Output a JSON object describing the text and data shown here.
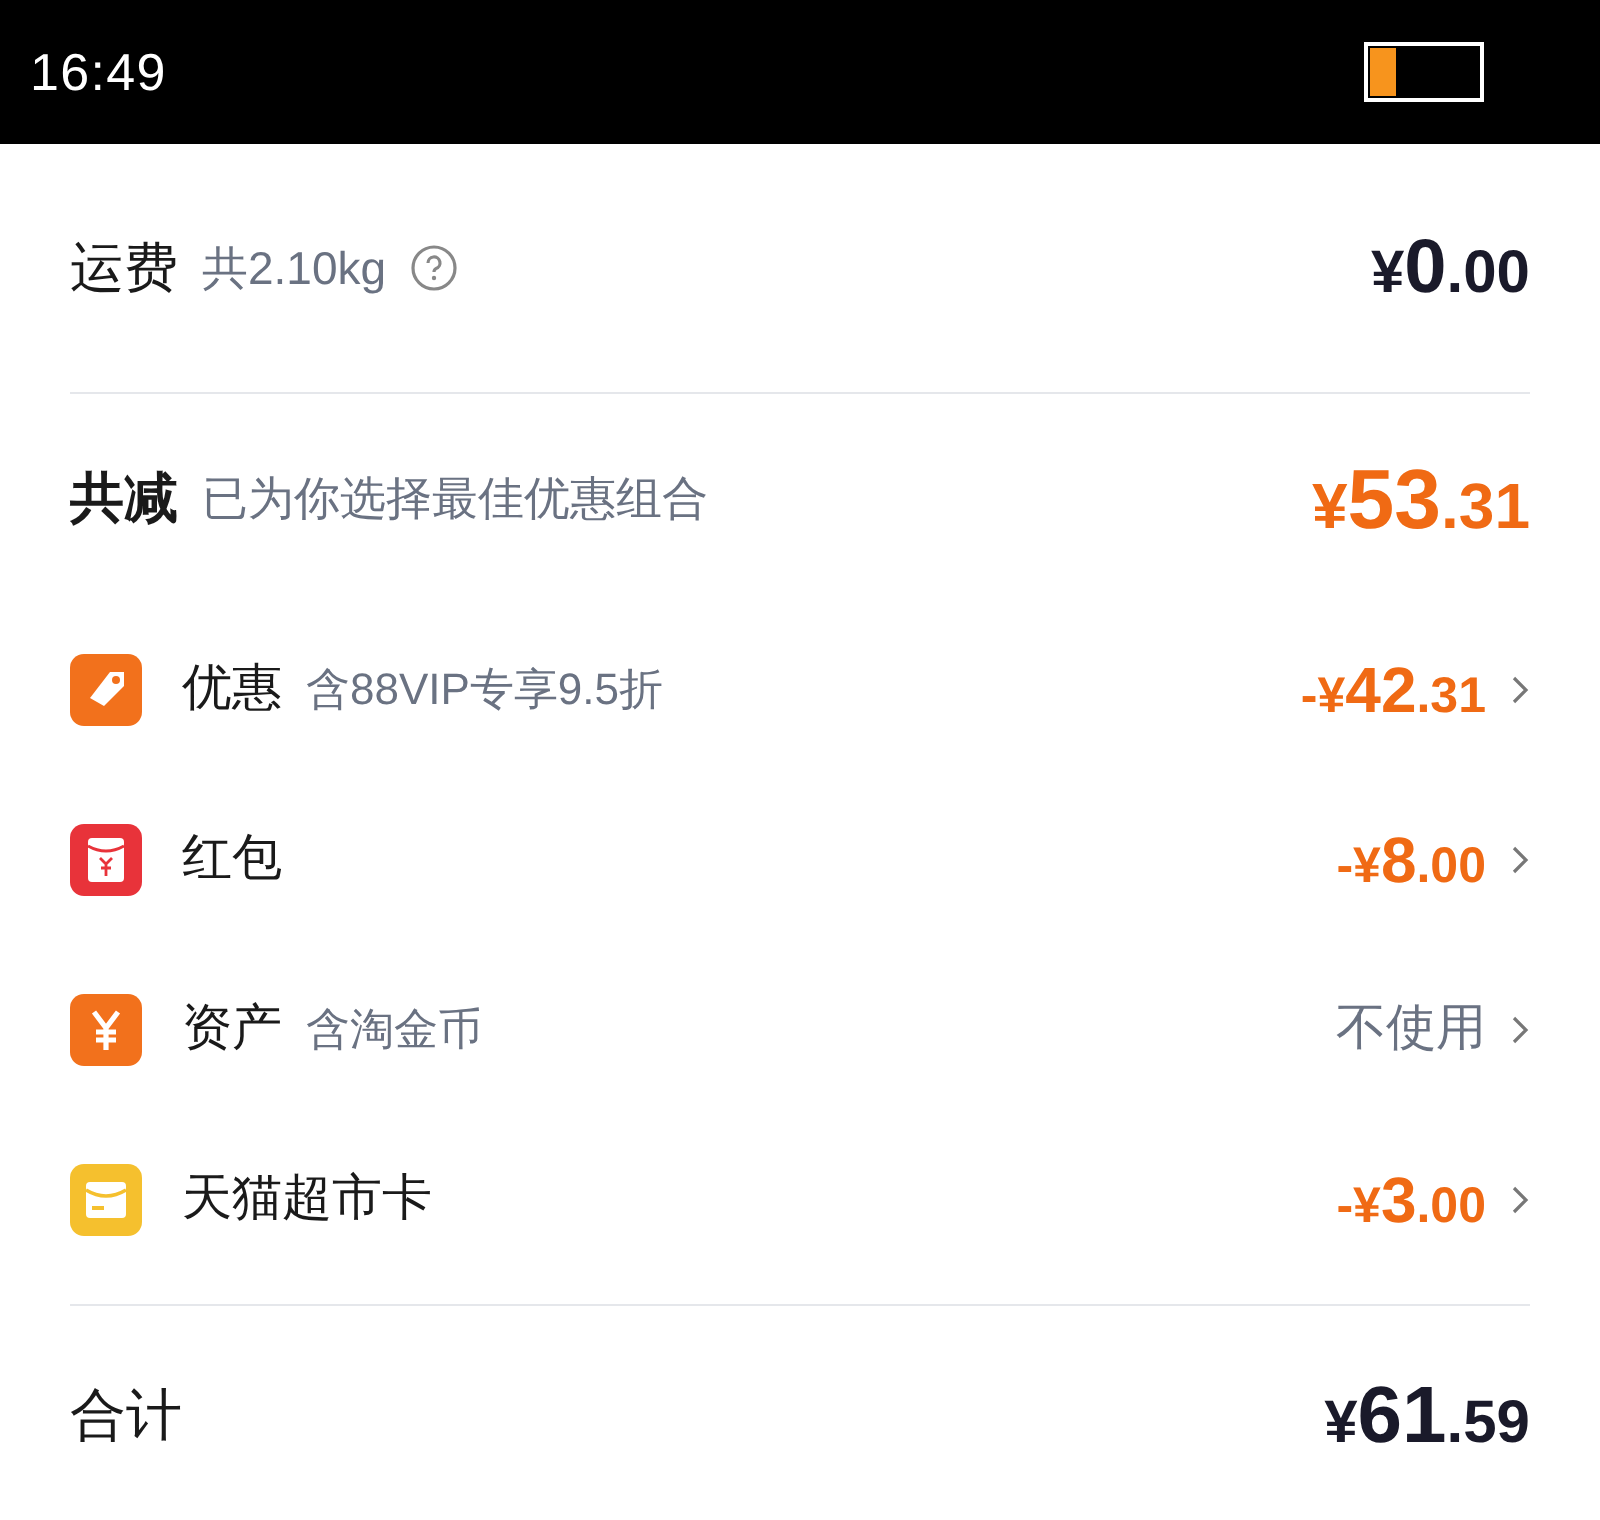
{
  "status_bar": {
    "time": "16:49"
  },
  "shipping": {
    "label": "运费",
    "detail": "共2.10kg",
    "amount": "¥0.00"
  },
  "reduction": {
    "label": "共减",
    "detail": "已为你选择最佳优惠组合",
    "amount": "¥53.31"
  },
  "items": [
    {
      "label": "优惠",
      "detail": "含88VIP专享9.5折",
      "kind": "amount",
      "value": "-¥42.31"
    },
    {
      "label": "红包",
      "kind": "amount",
      "value": "-¥8.00"
    },
    {
      "label": "资产",
      "detail": "含淘金币",
      "kind": "text",
      "value": "不使用"
    },
    {
      "label": "天猫超市卡",
      "kind": "amount",
      "value": "-¥3.00"
    }
  ],
  "total": {
    "label": "合计",
    "amount": "¥61.59"
  }
}
